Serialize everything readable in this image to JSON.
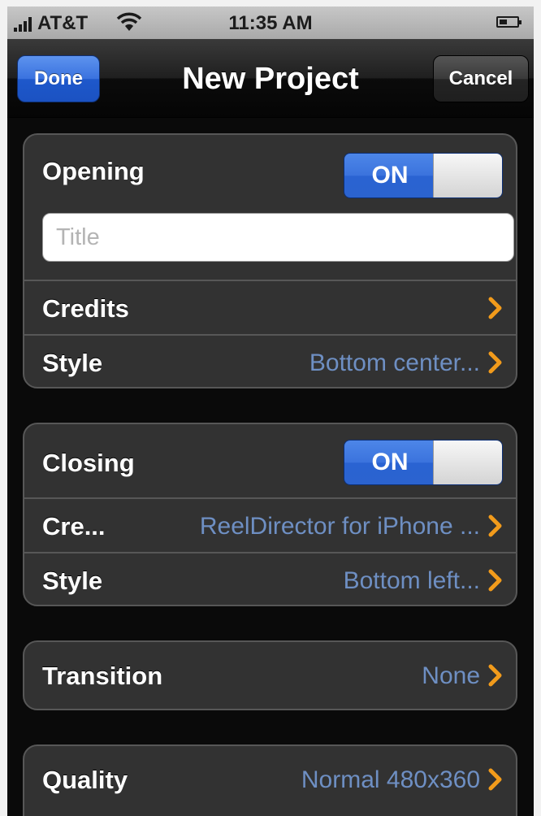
{
  "status_bar": {
    "carrier": "AT&T",
    "time": "11:35 AM",
    "icons": [
      "signal-bars-icon",
      "wifi-icon",
      "battery-icon"
    ]
  },
  "nav": {
    "title": "New Project",
    "done_label": "Done",
    "cancel_label": "Cancel"
  },
  "opening": {
    "label": "Opening",
    "toggle_label": "ON",
    "title_placeholder": "Title",
    "title_value": "",
    "credits_label": "Credits",
    "credits_value": "",
    "style_label": "Style",
    "style_value": "Bottom center..."
  },
  "closing": {
    "label": "Closing",
    "toggle_label": "ON",
    "credits_label": "Cre...",
    "credits_value": "ReelDirector for iPhone ...",
    "style_label": "Style",
    "style_value": "Bottom left..."
  },
  "transition": {
    "label": "Transition",
    "value": "None"
  },
  "quality": {
    "label": "Quality",
    "value": "Normal 480x360"
  },
  "colors": {
    "accent_blue": "#3b73dd",
    "value_text": "#6e8fc3",
    "chevron": "#f29b1b",
    "cell_bg": "#323232"
  }
}
